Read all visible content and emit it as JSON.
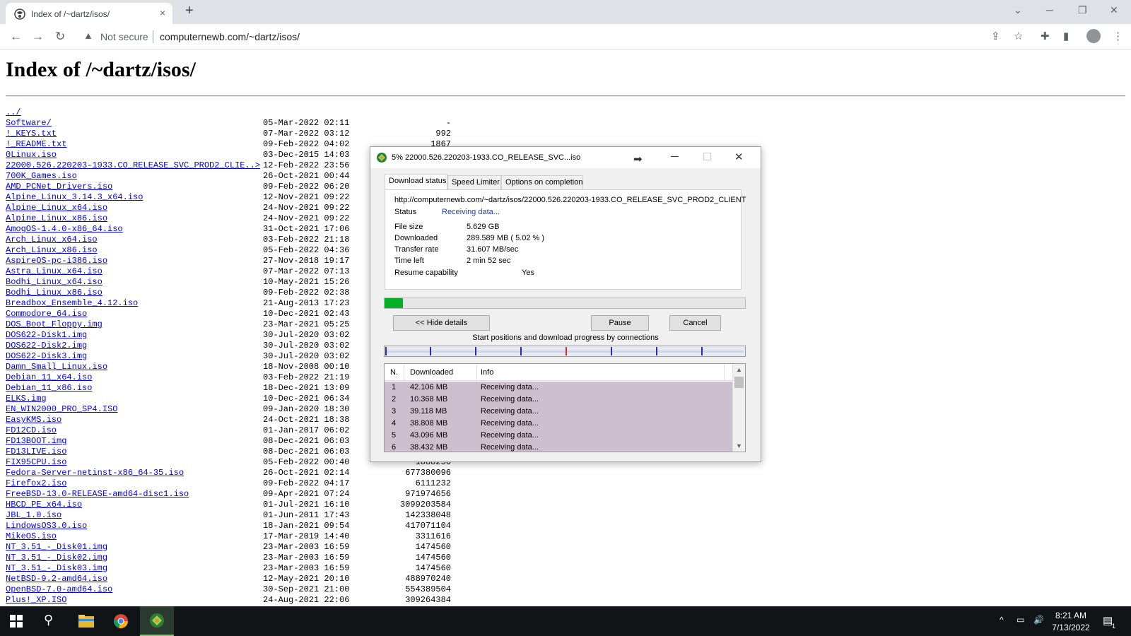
{
  "browser": {
    "tab_title": "Index of /~dartz/isos/",
    "tab_close": "×",
    "new_tab": "+",
    "security_label": "Not secure",
    "url": "computernewb.com/~dartz/isos/"
  },
  "page": {
    "heading": "Index of /~dartz/isos/",
    "files": [
      {
        "name": "../",
        "date": "",
        "size": ""
      },
      {
        "name": "Software/",
        "date": "05-Mar-2022 02:11",
        "size": "-"
      },
      {
        "name": "!_KEYS.txt",
        "date": "07-Mar-2022 03:12",
        "size": "992"
      },
      {
        "name": "!_README.txt",
        "date": "09-Feb-2022 04:02",
        "size": "1867"
      },
      {
        "name": "0Linux.iso",
        "date": "03-Dec-2015 14:03",
        "size": ""
      },
      {
        "name": "22000.526.220203-1933.CO_RELEASE_SVC_PROD2_CLIE..>",
        "date": "12-Feb-2022 23:56",
        "size": ""
      },
      {
        "name": "700K_Games.iso",
        "date": "26-Oct-2021 00:44",
        "size": ""
      },
      {
        "name": "AMD_PCNet_Drivers.iso",
        "date": "09-Feb-2022 06:20",
        "size": ""
      },
      {
        "name": "Alpine_Linux_3.14.3_x64.iso",
        "date": "12-Nov-2021 09:22",
        "size": ""
      },
      {
        "name": "Alpine_Linux_x64.iso",
        "date": "24-Nov-2021 09:22",
        "size": ""
      },
      {
        "name": "Alpine_Linux_x86.iso",
        "date": "24-Nov-2021 09:22",
        "size": ""
      },
      {
        "name": "AmogOS-1.4.0-x86_64.iso",
        "date": "31-Oct-2021 17:06",
        "size": ""
      },
      {
        "name": "Arch_Linux_x64.iso",
        "date": "03-Feb-2022 21:18",
        "size": ""
      },
      {
        "name": "Arch_Linux_x86.iso",
        "date": "05-Feb-2022 04:36",
        "size": ""
      },
      {
        "name": "AspireOS-pc-i386.iso",
        "date": "27-Nov-2018 19:17",
        "size": ""
      },
      {
        "name": "Astra_Linux_x64.iso",
        "date": "07-Mar-2022 07:13",
        "size": ""
      },
      {
        "name": "Bodhi_Linux_x64.iso",
        "date": "10-May-2021 15:26",
        "size": ""
      },
      {
        "name": "Bodhi_Linux_x86.iso",
        "date": "09-Feb-2022 02:38",
        "size": ""
      },
      {
        "name": "Breadbox_Ensemble_4.12.iso",
        "date": "21-Aug-2013 17:23",
        "size": ""
      },
      {
        "name": "Commodore_64.iso",
        "date": "10-Dec-2021 02:43",
        "size": ""
      },
      {
        "name": "DOS_Boot_Floppy.img",
        "date": "23-Mar-2021 05:25",
        "size": ""
      },
      {
        "name": "DOS622-Disk1.img",
        "date": "30-Jul-2020 03:02",
        "size": ""
      },
      {
        "name": "DOS622-Disk2.img",
        "date": "30-Jul-2020 03:02",
        "size": ""
      },
      {
        "name": "DOS622-Disk3.img",
        "date": "30-Jul-2020 03:02",
        "size": ""
      },
      {
        "name": "Damn_Small_Linux.iso",
        "date": "18-Nov-2008 00:10",
        "size": ""
      },
      {
        "name": "Debian_11_x64.iso",
        "date": "03-Feb-2022 21:19",
        "size": ""
      },
      {
        "name": "Debian_11_x86.iso",
        "date": "18-Dec-2021 13:09",
        "size": ""
      },
      {
        "name": "ELKS.img",
        "date": "10-Dec-2021 06:34",
        "size": ""
      },
      {
        "name": "EN_WIN2000_PRO_SP4.ISO",
        "date": "09-Jan-2020 18:30",
        "size": ""
      },
      {
        "name": "EasyKMS.iso",
        "date": "24-Oct-2021 18:38",
        "size": ""
      },
      {
        "name": "FD12CD.iso",
        "date": "01-Jan-2017 06:02",
        "size": ""
      },
      {
        "name": "FD13BOOT.img",
        "date": "08-Dec-2021 06:03",
        "size": ""
      },
      {
        "name": "FD13LIVE.iso",
        "date": "08-Dec-2021 06:03",
        "size": ""
      },
      {
        "name": "FIX95CPU.iso",
        "date": "05-Feb-2022 00:40",
        "size": "1888256"
      },
      {
        "name": "Fedora-Server-netinst-x86_64-35.iso",
        "date": "26-Oct-2021 02:14",
        "size": "677380096"
      },
      {
        "name": "Firefox2.iso",
        "date": "09-Feb-2022 04:17",
        "size": "6111232"
      },
      {
        "name": "FreeBSD-13.0-RELEASE-amd64-disc1.iso",
        "date": "09-Apr-2021 07:24",
        "size": "971974656"
      },
      {
        "name": "HBCD_PE_x64.iso",
        "date": "01-Jul-2021 16:10",
        "size": "3099203584"
      },
      {
        "name": "JBL_1.0.iso",
        "date": "01-Jun-2011 17:43",
        "size": "142338048"
      },
      {
        "name": "LindowsOS3.0.iso",
        "date": "18-Jan-2021 09:54",
        "size": "417071104"
      },
      {
        "name": "MikeOS.iso",
        "date": "17-Mar-2019 14:40",
        "size": "3311616"
      },
      {
        "name": "NT_3.51_-_Disk01.img",
        "date": "23-Mar-2003 16:59",
        "size": "1474560"
      },
      {
        "name": "NT_3.51_-_Disk02.img",
        "date": "23-Mar-2003 16:59",
        "size": "1474560"
      },
      {
        "name": "NT_3.51_-_Disk03.img",
        "date": "23-Mar-2003 16:59",
        "size": "1474560"
      },
      {
        "name": "NetBSD-9.2-amd64.iso",
        "date": "12-May-2021 20:10",
        "size": "488970240"
      },
      {
        "name": "OpenBSD-7.0-amd64.iso",
        "date": "30-Sep-2021 21:00",
        "size": "554389504"
      },
      {
        "name": "Plus!_XP.ISO",
        "date": "24-Aug-2021 22:06",
        "size": "309264384"
      }
    ]
  },
  "dialog": {
    "title": "5% 22000.526.220203-1933.CO_RELEASE_SVC...iso",
    "tabs": [
      "Download status",
      "Speed Limiter",
      "Options on completion"
    ],
    "url": "http://computernewb.com/~dartz/isos/22000.526.220203-1933.CO_RELEASE_SVC_PROD2_CLIENT",
    "status_label": "Status",
    "status_value": "Receiving data...",
    "file_size_label": "File size",
    "file_size": "5.629  GB",
    "downloaded_label": "Downloaded",
    "downloaded": "289.589  MB  ( 5.02 % )",
    "transfer_rate_label": "Transfer rate",
    "transfer_rate": "31.607  MB/sec",
    "time_left_label": "Time left",
    "time_left": "2 min 52 sec",
    "resume_label": "Resume capability",
    "resume": "Yes",
    "progress_fraction": 0.0502,
    "hide_details": "<< Hide details",
    "pause": "Pause",
    "cancel": "Cancel",
    "connections_label": "Start positions and download progress by connections",
    "table_headers": [
      "N.",
      "Downloaded",
      "Info"
    ],
    "connections": [
      {
        "n": "1",
        "downloaded": "42.106  MB",
        "info": "Receiving data..."
      },
      {
        "n": "2",
        "downloaded": "10.368  MB",
        "info": "Receiving data..."
      },
      {
        "n": "3",
        "downloaded": "39.118  MB",
        "info": "Receiving data..."
      },
      {
        "n": "4",
        "downloaded": "38.808  MB",
        "info": "Receiving data..."
      },
      {
        "n": "5",
        "downloaded": "43.096  MB",
        "info": "Receiving data..."
      },
      {
        "n": "6",
        "downloaded": "38.432  MB",
        "info": "Receiving data..."
      }
    ],
    "accent_green": "#06b025"
  },
  "taskbar": {
    "time": "8:21 AM",
    "date": "7/13/2022",
    "notification_count": "1"
  }
}
